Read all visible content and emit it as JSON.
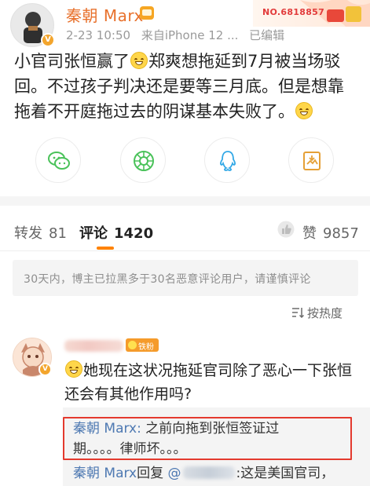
{
  "post": {
    "username": "秦朝 Marx",
    "date": "2-23 10:50",
    "source": "来自iPhone 12 ...",
    "edited": "已编辑",
    "fan_number": "NO.6818857",
    "text_1": "小官司张恒赢了",
    "text_2": "郑爽想拖延到7月被当场驳回。不过孩子判决还是要等三月底。但是想靠拖着不开庭拖过去的阴谋基本失败了。",
    "emoji": "grin-emoji"
  },
  "share_buttons": [
    {
      "name": "wechat-icon"
    },
    {
      "name": "moments-icon"
    },
    {
      "name": "qq-icon"
    },
    {
      "name": "save-image-icon"
    }
  ],
  "tabs": {
    "repost_label": "转发",
    "repost_count": "81",
    "comment_label": "评论",
    "comment_count": "1420",
    "like_label": "赞",
    "like_count": "9857"
  },
  "notice": "30天内，博主已拉黑多于30名恶意评论用户，请谨慎评论",
  "sort_label": "按热度",
  "comment": {
    "badge": "铁粉",
    "text": "她现在这状况拖延官司除了恶心一下张恒还会有其他作用吗?"
  },
  "replies": [
    {
      "name": "秦朝 Marx",
      "sep": ": ",
      "line1": "之前向拖到张恒签证过",
      "line2": "期。。。。律师坏。。。"
    },
    {
      "name": "秦朝 Marx",
      "action": "回复",
      "at": "@",
      "text": ":这是美国官司，"
    }
  ],
  "colors": {
    "accent_orange": "#ff8200",
    "username_orange": "#e8712c",
    "link_blue": "#4e79b2",
    "highlight_red": "#e43a2e"
  }
}
